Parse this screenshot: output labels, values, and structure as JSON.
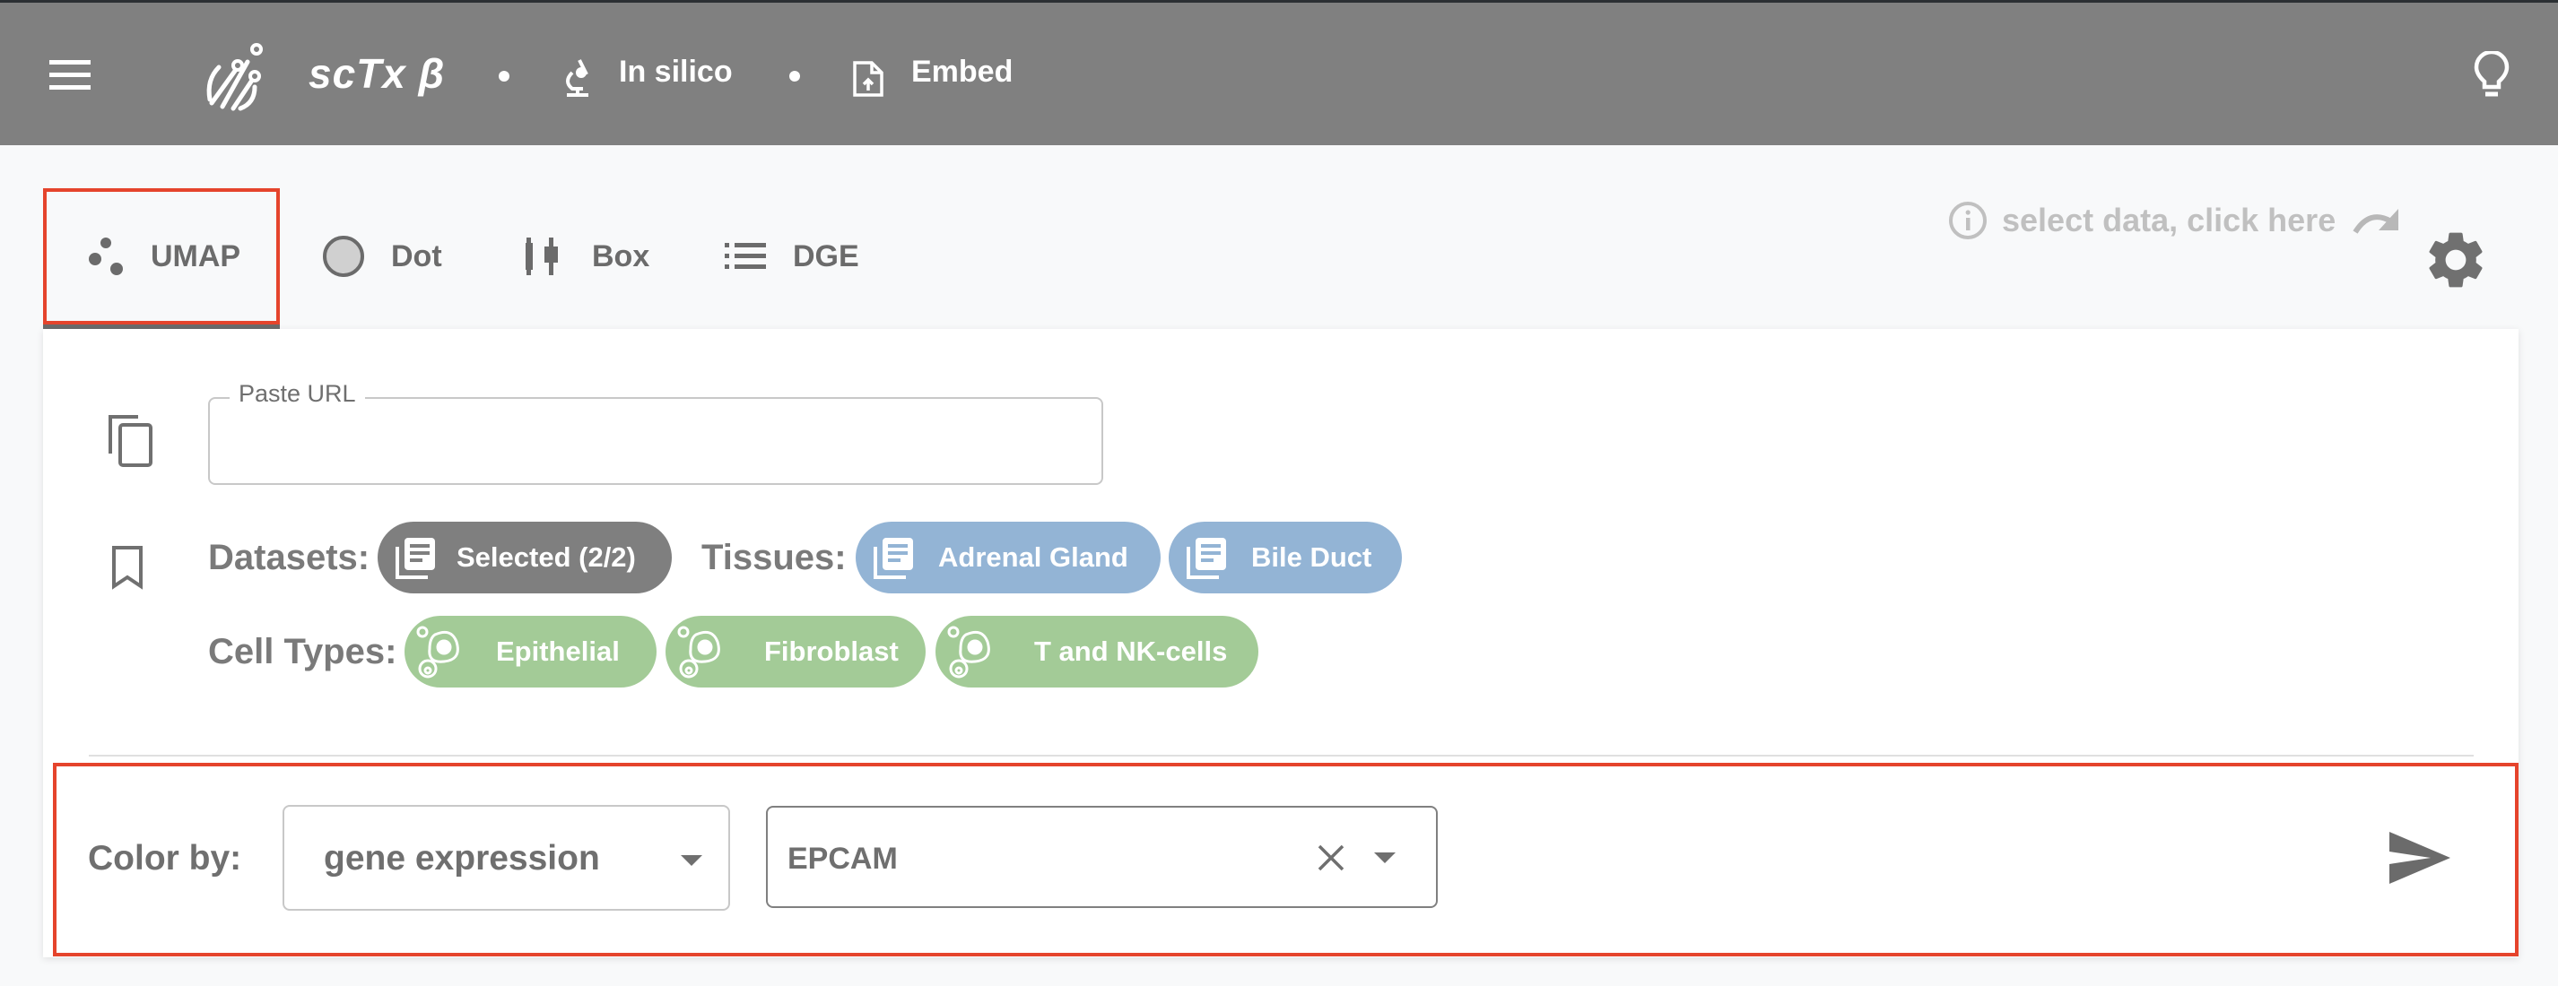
{
  "header": {
    "menu_icon": "hamburger-menu-icon",
    "logo_icon": "sctx-logo-icon",
    "title": "scTx β",
    "links": [
      {
        "label": "In silico",
        "icon": "microscope-icon"
      },
      {
        "label": "Embed",
        "icon": "file-upload-icon"
      }
    ],
    "right_icon": "lightbulb-icon"
  },
  "tabs": [
    {
      "label": "UMAP",
      "icon": "scatter-dots-icon",
      "active": true
    },
    {
      "label": "Dot",
      "icon": "circle-icon",
      "active": false
    },
    {
      "label": "Box",
      "icon": "boxplot-icon",
      "active": false
    },
    {
      "label": "DGE",
      "icon": "list-icon",
      "active": false
    }
  ],
  "hint": {
    "text": "select data, click here",
    "icon": "info-icon",
    "arrow_icon": "redo-arrow-icon"
  },
  "settings_icon": "gear-icon",
  "url_field": {
    "label": "Paste URL",
    "value": "",
    "icon": "copy-icon"
  },
  "selection": {
    "icon": "bookmark-icon",
    "datasets_label": "Datasets:",
    "datasets": [
      {
        "label": "Selected (2/2)",
        "icon": "library-books-icon"
      }
    ],
    "tissues_label": "Tissues:",
    "tissues": [
      {
        "label": "Adrenal Gland",
        "icon": "library-books-icon"
      },
      {
        "label": "Bile Duct",
        "icon": "library-books-icon"
      }
    ],
    "celltypes_label": "Cell Types:",
    "celltypes": [
      {
        "label": "Epithelial",
        "icon": "cell-icon"
      },
      {
        "label": "Fibroblast",
        "icon": "cell-icon"
      },
      {
        "label": "T and NK-cells",
        "icon": "cell-icon"
      }
    ]
  },
  "color_by": {
    "label": "Color by:",
    "selected": "gene expression",
    "gene": "EPCAM",
    "clear_icon": "close-icon",
    "dropdown_icon": "caret-down-icon",
    "send_icon": "send-icon"
  },
  "colors": {
    "header_bg": "#808080",
    "accent_highlight": "#e5442c",
    "chip_dataset": "#7f7f7f",
    "chip_tissue": "#93b4d5",
    "chip_celltype": "#a3cb97",
    "text": "#6f6f6f"
  }
}
